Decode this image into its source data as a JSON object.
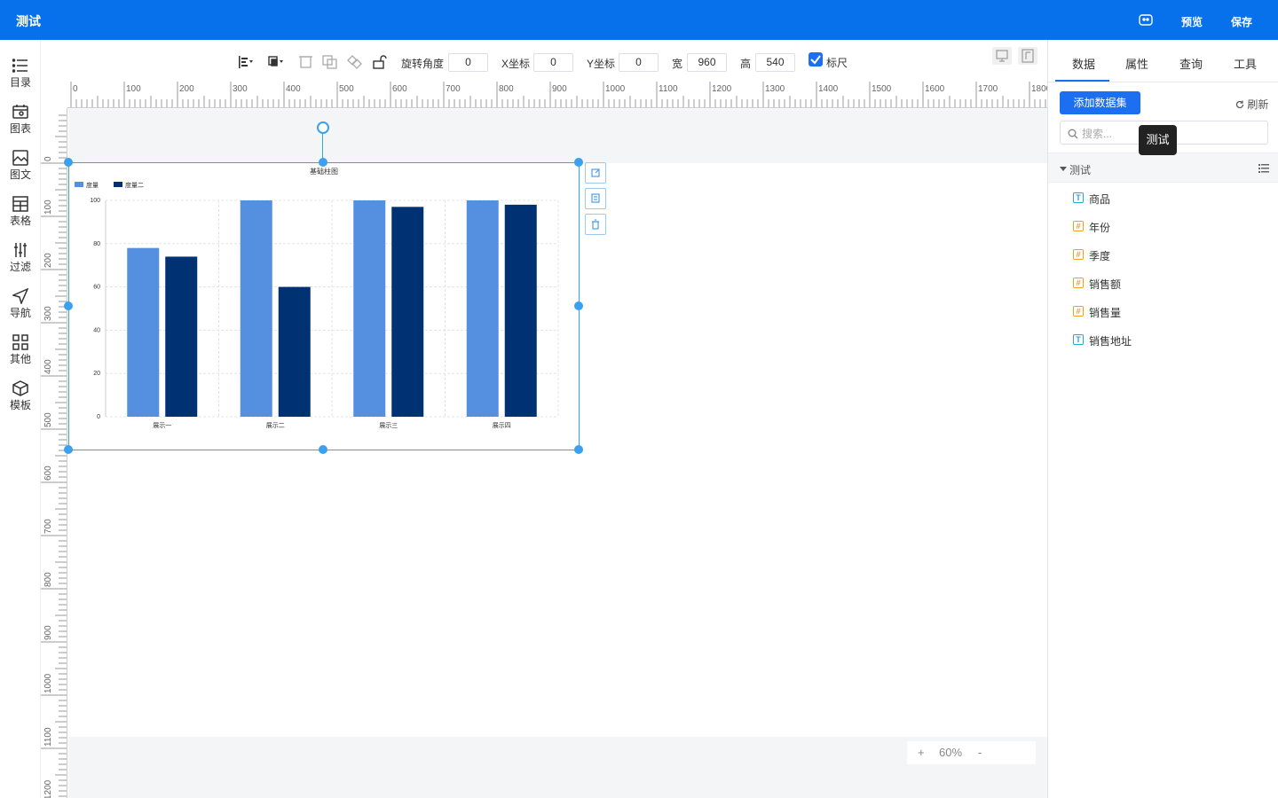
{
  "header": {
    "title": "测试",
    "preview": "预览",
    "save": "保存"
  },
  "sidebar": {
    "items": [
      {
        "label": "目录",
        "icon": "list-icon"
      },
      {
        "label": "图表",
        "icon": "chart-icon"
      },
      {
        "label": "图文",
        "icon": "image-text-icon"
      },
      {
        "label": "表格",
        "icon": "table-icon"
      },
      {
        "label": "过滤",
        "icon": "filter-icon"
      },
      {
        "label": "导航",
        "icon": "navigation-icon"
      },
      {
        "label": "其他",
        "icon": "grid-icon"
      },
      {
        "label": "模板",
        "icon": "template-icon"
      }
    ]
  },
  "toolbar": {
    "rotation_label": "旋转角度",
    "rotation_value": "0",
    "x_label": "X坐标",
    "x_value": "0",
    "y_label": "Y坐标",
    "y_value": "0",
    "width_label": "宽",
    "width_value": "960",
    "height_label": "高",
    "height_value": "540",
    "ruler_label": "标尺",
    "ruler_checked": true
  },
  "ruler": {
    "top_labels": [
      "0",
      "100",
      "200",
      "300",
      "400",
      "500",
      "600",
      "700",
      "800",
      "900",
      "1000",
      "1100",
      "1200",
      "1300",
      "1400",
      "1500",
      "1600",
      "1700",
      "1800"
    ],
    "left_labels": [
      "0",
      "100",
      "200",
      "300",
      "400",
      "500",
      "600",
      "700",
      "800",
      "900",
      "1000",
      "1100",
      "1200"
    ]
  },
  "chart_data": {
    "type": "bar",
    "title": "基础柱图",
    "categories": [
      "展示一",
      "展示二",
      "展示三",
      "展示四"
    ],
    "series": [
      {
        "name": "度量",
        "color": "#5590e0",
        "values": [
          78,
          100,
          100,
          100
        ]
      },
      {
        "name": "度量二",
        "color": "#003273",
        "values": [
          74,
          60,
          97,
          98
        ]
      }
    ],
    "ylim": [
      0,
      100
    ],
    "yticks": [
      "0",
      "20",
      "40",
      "60",
      "80",
      "100"
    ],
    "grid": true,
    "legend": "top-left"
  },
  "zoom": {
    "plus": "+",
    "level": "60%",
    "minus": "-"
  },
  "rightpanel": {
    "tabs": [
      "数据",
      "属性",
      "查询",
      "工具"
    ],
    "active_tab": "数据",
    "add_dataset": "添加数据集",
    "refresh": "刷新",
    "search_placeholder": "搜索...",
    "tooltip": "测试",
    "group_name": "测试",
    "fields": [
      {
        "name": "商品",
        "type": "T",
        "color": "#2aa8c8"
      },
      {
        "name": "年份",
        "type": "#",
        "color": "#f0a020"
      },
      {
        "name": "季度",
        "type": "#",
        "color": "#f0a020"
      },
      {
        "name": "销售额",
        "type": "#",
        "color": "#f0a020"
      },
      {
        "name": "销售量",
        "type": "#",
        "color": "#f0a020"
      },
      {
        "name": "销售地址",
        "type": "T",
        "color": "#2aa8c8"
      }
    ]
  }
}
